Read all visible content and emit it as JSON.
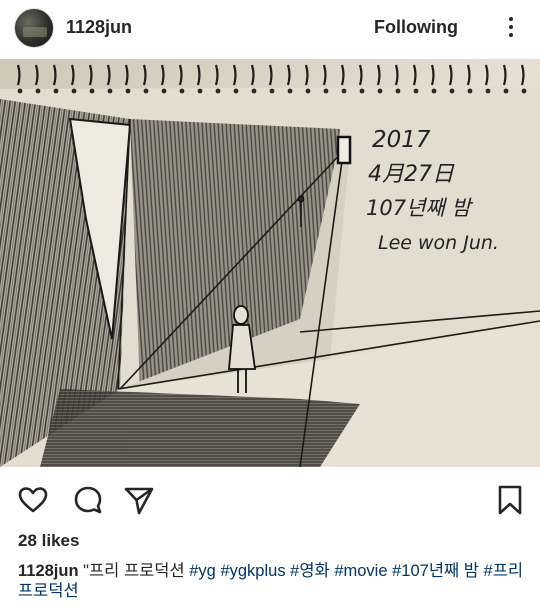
{
  "header": {
    "username": "1128jun",
    "follow_status": "Following"
  },
  "photo": {
    "handwritten_note": [
      "2017",
      "4月27日",
      "107년째 밤",
      "Lee won Jun."
    ]
  },
  "actions": {
    "like_icon": "heart-icon",
    "comment_icon": "comment-icon",
    "share_icon": "share-icon",
    "save_icon": "bookmark-icon"
  },
  "likes": "28 likes",
  "caption": {
    "username": "1128jun",
    "text": "\"프리 프로덕션 ",
    "hashtags": [
      "#yg",
      "#ygkplus",
      "#영화",
      "#movie",
      "#107년째",
      "밤 #프리프로덕션"
    ]
  },
  "colors": {
    "text": "#262626",
    "hashtag": "#003569",
    "paper": "#d9d1c2"
  }
}
